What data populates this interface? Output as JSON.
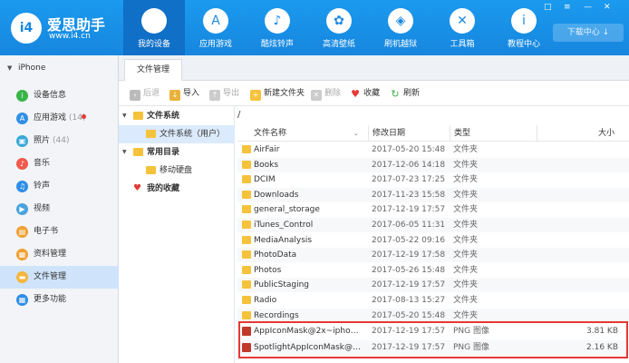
{
  "app": {
    "title": "爱思助手",
    "url": "www.i4.cn",
    "logo_text": "i4",
    "download_center": "下载中心",
    "download_icon": "download-arrow-icon",
    "accent": "#1788e0"
  },
  "nav": [
    {
      "label": "我的设备",
      "icon": "apple-icon",
      "glyph": ""
    },
    {
      "label": "应用游戏",
      "icon": "app-store-icon",
      "glyph": "A"
    },
    {
      "label": "酷炫铃声",
      "icon": "bell-icon",
      "glyph": "♪"
    },
    {
      "label": "高清壁纸",
      "icon": "wallpaper-icon",
      "glyph": "✿"
    },
    {
      "label": "刷机越狱",
      "icon": "dropbox-icon",
      "glyph": "◈"
    },
    {
      "label": "工具箱",
      "icon": "tools-icon",
      "glyph": "✕"
    },
    {
      "label": "教程中心",
      "icon": "info-icon",
      "glyph": "i"
    }
  ],
  "window_controls": [
    "□",
    "≡",
    "—",
    "✕"
  ],
  "sidebar": {
    "device": "iPhone",
    "items": [
      {
        "label": "设备信息",
        "count": "",
        "icon": "info-icon",
        "color": "#3ab449",
        "glyph": "i"
      },
      {
        "label": "应用游戏",
        "count": "(14)",
        "icon": "app-store-icon",
        "color": "#2f8ee6",
        "glyph": "A"
      },
      {
        "label": "照片",
        "count": "(44)",
        "icon": "photo-icon",
        "color": "#37a9d8",
        "glyph": "▣"
      },
      {
        "label": "音乐",
        "count": "",
        "icon": "music-icon",
        "color": "#ef5a4c",
        "glyph": "♪"
      },
      {
        "label": "铃声",
        "count": "",
        "icon": "bell-icon",
        "color": "#2f8ee6",
        "glyph": "♫"
      },
      {
        "label": "视频",
        "count": "",
        "icon": "video-icon",
        "color": "#4aa3df",
        "glyph": "▶"
      },
      {
        "label": "电子书",
        "count": "",
        "icon": "book-icon",
        "color": "#f0a030",
        "glyph": "▤"
      },
      {
        "label": "资料管理",
        "count": "",
        "icon": "contacts-icon",
        "color": "#f0a030",
        "glyph": "▦"
      },
      {
        "label": "文件管理",
        "count": "",
        "icon": "file-icon",
        "color": "#f5b63b",
        "glyph": "▬"
      },
      {
        "label": "更多功能",
        "count": "",
        "icon": "grid-icon",
        "color": "#2f8ee6",
        "glyph": "▦"
      }
    ]
  },
  "tab": "文件管理",
  "toolbar": [
    {
      "label": "后退",
      "icon": "back-icon",
      "disabled": true,
      "color": "#bbb",
      "glyph": "‹"
    },
    {
      "label": "导入",
      "icon": "import-icon",
      "disabled": false,
      "color": "#e9b23a",
      "glyph": "↓"
    },
    {
      "label": "导出",
      "icon": "export-icon",
      "disabled": true,
      "color": "#ccc",
      "glyph": "↑"
    },
    {
      "label": "新建文件夹",
      "icon": "new-folder-icon",
      "disabled": false,
      "color": "#f5c33b",
      "glyph": "+"
    },
    {
      "label": "删除",
      "icon": "delete-icon",
      "disabled": true,
      "color": "#ccc",
      "glyph": "✕"
    },
    {
      "label": "收藏",
      "icon": "heart-icon",
      "disabled": false,
      "color": "#e53935",
      "glyph": "♥"
    },
    {
      "label": "刷新",
      "icon": "refresh-icon",
      "disabled": false,
      "color": "#3ab449",
      "glyph": "↻"
    }
  ],
  "tree": [
    {
      "label": "文件系统",
      "level": 0,
      "expandable": true,
      "icon": "folder-icon"
    },
    {
      "label": "文件系统（用户）",
      "level": 1,
      "expandable": false,
      "icon": "folder-icon",
      "selected": true
    },
    {
      "label": "常用目录",
      "level": 0,
      "expandable": true,
      "icon": "folder-icon"
    },
    {
      "label": "移动硬盘",
      "level": 1,
      "expandable": false,
      "icon": "folder-icon"
    },
    {
      "label": "我的收藏",
      "level": 0,
      "expandable": false,
      "icon": "heart-icon"
    }
  ],
  "path": "/",
  "columns": {
    "name": "文件名称",
    "date": "修改日期",
    "type": "类型",
    "size": "大小"
  },
  "files": [
    {
      "name": "AirFair",
      "date": "2017-05-20 15:48:...",
      "type": "文件夹",
      "size": "",
      "kind": "folder"
    },
    {
      "name": "Books",
      "date": "2017-12-06 14:18:...",
      "type": "文件夹",
      "size": "",
      "kind": "folder"
    },
    {
      "name": "DCIM",
      "date": "2017-07-23 17:25:...",
      "type": "文件夹",
      "size": "",
      "kind": "folder"
    },
    {
      "name": "Downloads",
      "date": "2017-11-23 15:58:...",
      "type": "文件夹",
      "size": "",
      "kind": "folder"
    },
    {
      "name": "general_storage",
      "date": "2017-12-19 17:57:...",
      "type": "文件夹",
      "size": "",
      "kind": "folder"
    },
    {
      "name": "iTunes_Control",
      "date": "2017-06-05 11:31:...",
      "type": "文件夹",
      "size": "",
      "kind": "folder"
    },
    {
      "name": "MediaAnalysis",
      "date": "2017-05-22 09:16:...",
      "type": "文件夹",
      "size": "",
      "kind": "folder"
    },
    {
      "name": "PhotoData",
      "date": "2017-12-19 17:58:...",
      "type": "文件夹",
      "size": "",
      "kind": "folder"
    },
    {
      "name": "Photos",
      "date": "2017-05-26 15:48:...",
      "type": "文件夹",
      "size": "",
      "kind": "folder"
    },
    {
      "name": "PublicStaging",
      "date": "2017-12-19 17:57:...",
      "type": "文件夹",
      "size": "",
      "kind": "folder"
    },
    {
      "name": "Radio",
      "date": "2017-08-13 15:27:...",
      "type": "文件夹",
      "size": "",
      "kind": "folder"
    },
    {
      "name": "Recordings",
      "date": "2017-05-20 15:48:...",
      "type": "文件夹",
      "size": "",
      "kind": "folder"
    },
    {
      "name": "AppIconMask@2x~iphone....",
      "date": "2017-12-19 17:57:...",
      "type": "PNG 图像",
      "size": "3.81 KB",
      "kind": "png"
    },
    {
      "name": "SpotlightAppIconMask@2x...",
      "date": "2017-12-19 17:57:...",
      "type": "PNG 图像",
      "size": "2.16 KB",
      "kind": "png"
    }
  ]
}
